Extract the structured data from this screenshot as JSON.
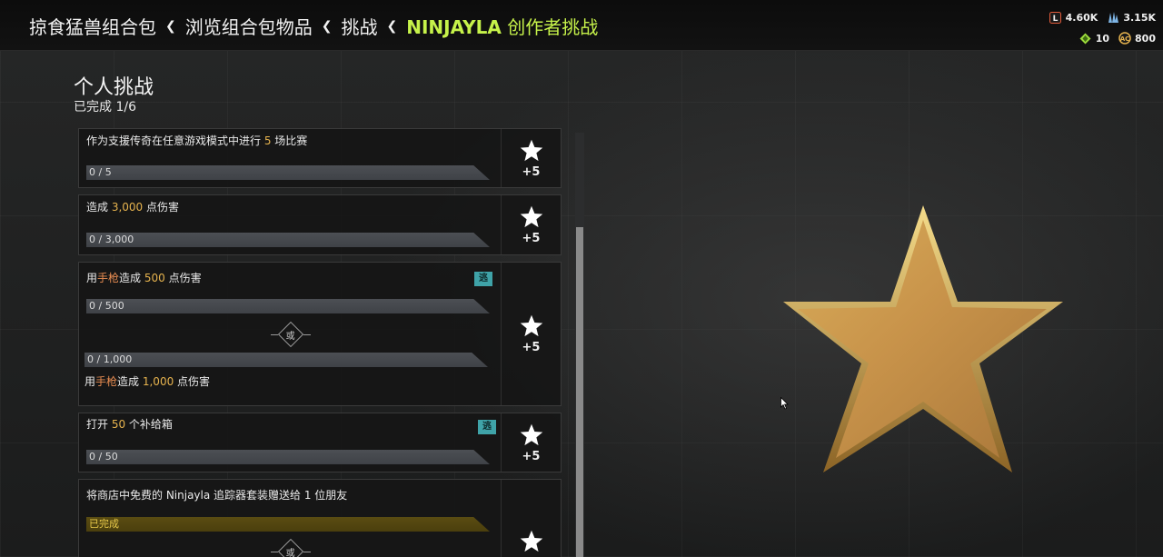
{
  "breadcrumb": [
    {
      "label": "掠食猛兽组合包",
      "active": false
    },
    {
      "label": "浏览组合包物品",
      "active": false
    },
    {
      "label": "挑战",
      "active": false
    },
    {
      "label_latin": "NINJAYLA",
      "label_cn": " 创作者挑战",
      "active": true
    }
  ],
  "currency": {
    "legend_tokens": "4.60K",
    "apex_coins_alt": "3.15K",
    "crafting": "10",
    "coins": "800"
  },
  "section": {
    "title": "个人挑战",
    "progress": "已完成 1/6"
  },
  "challenges": [
    {
      "title_pre": "作为支援传奇在任意游戏模式中进行 ",
      "title_num": "5",
      "title_post": " 场比赛",
      "progress": "0 / 5",
      "progress_fraction": 0,
      "reward": "+5"
    },
    {
      "title_pre": "造成 ",
      "title_num": "3,000",
      "title_post": " 点伤害",
      "progress": "0 / 3,000",
      "progress_fraction": 0,
      "reward": "+5"
    },
    {
      "title_a_pre": "用",
      "title_a_weapon": "手枪",
      "title_a_mid": "造成 ",
      "title_a_num": "500",
      "title_a_post": " 点伤害",
      "progress_a": "0 / 500",
      "or_label": "或",
      "progress_b": "0 / 1,000",
      "title_b_pre": "用",
      "title_b_weapon": "手枪",
      "title_b_mid": "造成 ",
      "title_b_num": "1,000",
      "title_b_post": " 点伤害",
      "badge": "逃",
      "reward": "+5"
    },
    {
      "title_pre": "打开 ",
      "title_num": "50",
      "title_post": " 个补给箱",
      "progress": "0 / 50",
      "progress_fraction": 0,
      "badge": "逃",
      "reward": "+5"
    },
    {
      "title": "将商店中免费的 Ninjayla 追踪器套装赠送给 1 位朋友",
      "progress": "已完成",
      "progress_fraction": 1,
      "or_label": "或"
    }
  ],
  "colors": {
    "accent": "#c6f24a",
    "gold": "#e6b34e",
    "badge": "#3fa3a8",
    "done": "#e8c94a"
  }
}
